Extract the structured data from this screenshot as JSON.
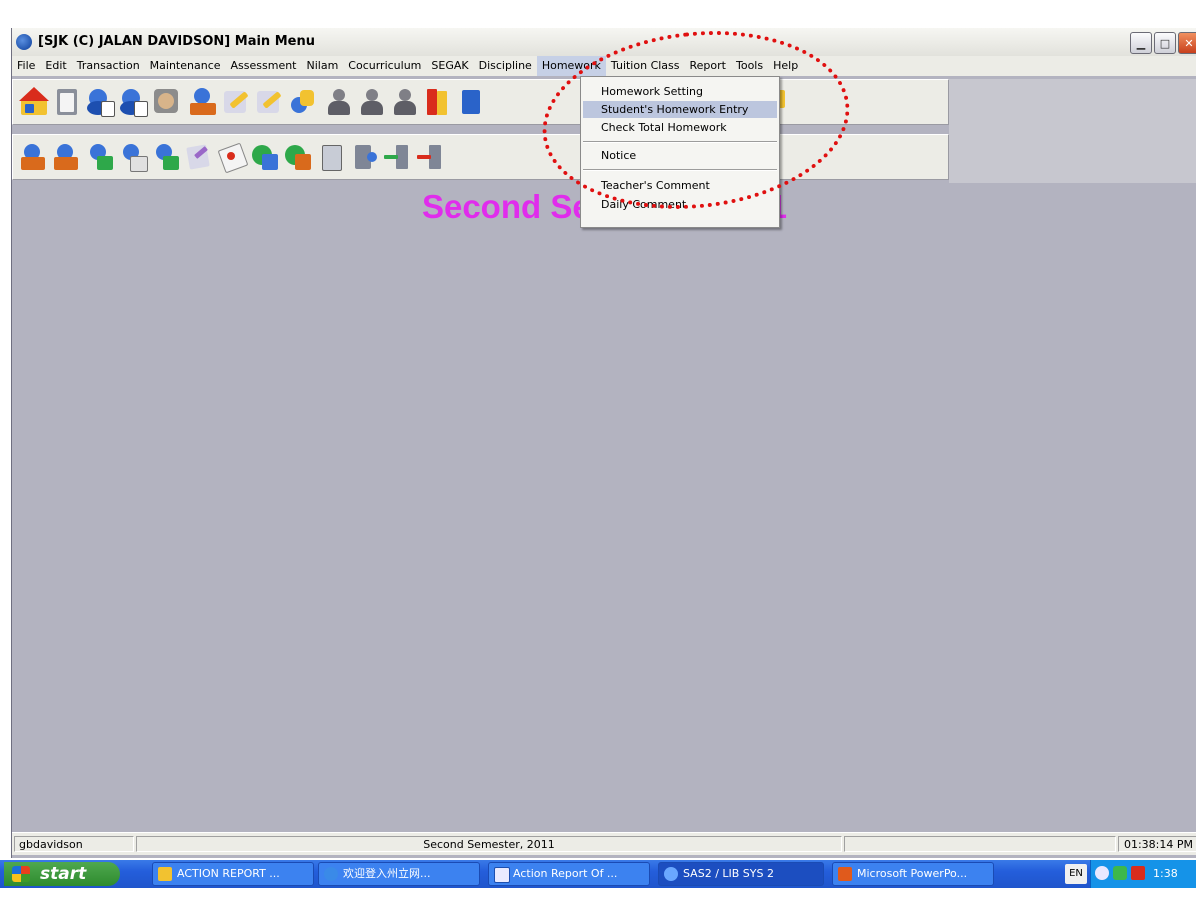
{
  "window": {
    "title": "[SJK (C) JALAN DAVIDSON] Main Menu"
  },
  "menubar": {
    "items": [
      "File",
      "Edit",
      "Transaction",
      "Maintenance",
      "Assessment",
      "Nilam",
      "Cocurriculum",
      "SEGAK",
      "Discipline",
      "Homework",
      "Tuition Class",
      "Report",
      "Tools",
      "Help"
    ],
    "active": "Homework"
  },
  "homework_menu": {
    "items": [
      {
        "label": "Homework Setting"
      },
      {
        "label": "Student's Homework Entry",
        "highlighted": true
      },
      {
        "label": "Check Total Homework"
      },
      {
        "label": "Notice"
      },
      {
        "label": "Teacher's Comment"
      },
      {
        "label": "Daily Comment"
      }
    ]
  },
  "main": {
    "semester_title": "Second Semester, 2011"
  },
  "statusbar": {
    "user": "gbdavidson",
    "semester": "Second Semester, 2011",
    "time": "01:38:14 PM"
  },
  "taskbar": {
    "start_label": "start",
    "tasks": [
      {
        "label": "ACTION REPORT ...",
        "icon": "folder-icon"
      },
      {
        "label": "欢迎登入州立网...",
        "icon": "ie-icon"
      },
      {
        "label": "Action Report Of ...",
        "icon": "word-icon"
      },
      {
        "label": "SAS2 / LIB SYS 2",
        "icon": "sas-icon",
        "active": true
      },
      {
        "label": "Microsoft PowerPo...",
        "icon": "powerpoint-icon"
      }
    ],
    "language": "EN",
    "clock": "1:38 PM"
  },
  "colors": {
    "semester_title": "#e02cec",
    "annotation": "#e01010",
    "taskbar": "#245edb",
    "workspace": "#b3b3c0"
  }
}
